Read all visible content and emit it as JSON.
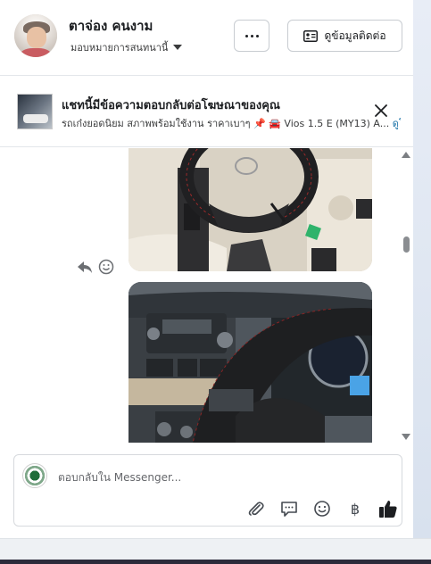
{
  "header": {
    "contact_name": "ตาจ่อง คนงาม",
    "assign_label": "มอบหมายการสนทนานี้",
    "contact_info_label": "ดูข้อมูลติดต่อ"
  },
  "ad_banner": {
    "title": "แชทนี้มีข้อความตอบกลับต่อโฆษณาของคุณ",
    "subtitle": "รถเก๋งยอดนิยม สภาพพร้อมใช้งาน ราคาเบาๆ 📌 🚘 Vios 1.5 E (MY13) A...",
    "more_link": "ดูโ"
  },
  "composer": {
    "placeholder": "ตอบกลับใน Messenger..."
  },
  "icons": {
    "more": "more-horizontal-icon",
    "contact_card": "contact-card-icon",
    "close": "close-icon",
    "reply": "reply-icon",
    "react": "smiley-icon",
    "attach": "paperclip-icon",
    "saved_replies": "chat-bubble-icon",
    "emoji": "emoji-icon",
    "payment": "baht-icon",
    "like": "thumbs-up-icon"
  },
  "payment_symbol": "฿",
  "colors": {
    "link": "#1a73a8",
    "border": "#c8ccd1"
  }
}
